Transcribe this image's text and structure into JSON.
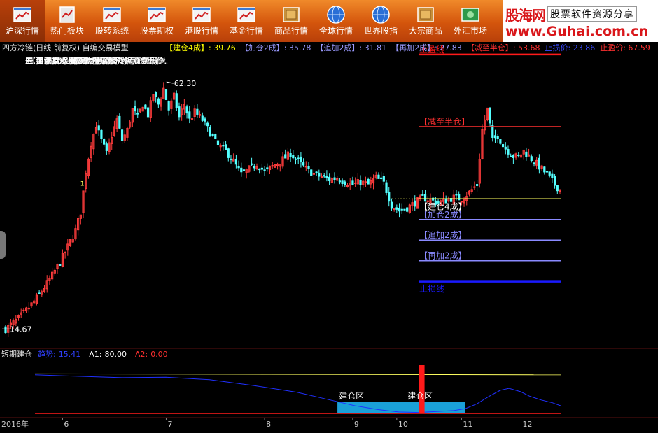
{
  "toolbar": {
    "buttons": [
      {
        "label": "沪深行情",
        "icon": "chart-window-icon",
        "active": true
      },
      {
        "label": "热门板块",
        "icon": "bookmark-icon",
        "active": false
      },
      {
        "label": "股转系统",
        "icon": "chart-window-icon",
        "active": false
      },
      {
        "label": "股票期权",
        "icon": "chart-window-icon",
        "active": false
      },
      {
        "label": "港股行情",
        "icon": "chart-window-icon",
        "active": false
      },
      {
        "label": "基金行情",
        "icon": "chart-window-icon",
        "active": false
      },
      {
        "label": "商品行情",
        "icon": "crate-icon",
        "active": false
      },
      {
        "label": "全球行情",
        "icon": "globe-icon",
        "active": false
      },
      {
        "label": "世界股指",
        "icon": "globe-icon",
        "active": false
      },
      {
        "label": "大宗商品",
        "icon": "box-icon",
        "active": false
      },
      {
        "label": "外汇市场",
        "icon": "money-icon",
        "active": false
      }
    ]
  },
  "brand": {
    "logo": "股海网",
    "slogan": "股票软件资源分享",
    "url": "www.Guhai.com.cn"
  },
  "chart_title": "四方冷链(日线 前复权) 自编交易模型",
  "header_indicators": [
    {
      "label": "【建仓4成】",
      "value": ": 39.76",
      "color": "#ffff00"
    },
    {
      "label": "【加仓2成】",
      "value": ": 35.78",
      "color": "#9a9aff"
    },
    {
      "label": "【追加2成】",
      "value": ": 31.81",
      "color": "#9a9aff"
    },
    {
      "label": "【再加2成】",
      "value": ": 27.83",
      "color": "#9a9aff"
    },
    {
      "label": "【减至半仓】",
      "value": ": 53.68",
      "color": "#ff3030"
    },
    {
      "label": "止损价",
      "value": ": 23.86",
      "color": "#3a4aff"
    },
    {
      "label": "止盈价",
      "value": ": 67.59",
      "color": "#ff3030"
    }
  ],
  "rules": [
    "【自编交易模型】探索版",
    "一.买入指标出现信号后建仓,用4成仓位.",
    "二.每跌10%加2成仓,加3次仓,直到满仓.",
    "三.上涨35%减至半仓.",
    "四.上涨70%清仓,或视情况移动止盈.",
    "五.建仓后上涨70%止盈,下跌40%止损!"
  ],
  "price_annotations": {
    "high": "62.30",
    "low": "14.67",
    "signal": "1"
  },
  "level_labels": {
    "take_profit": "止盈线",
    "reduce": "【减至半仓】",
    "build": "【建仓4成】",
    "add1": "【加仓2成】",
    "add2": "【追加2成】",
    "add3": "【再加2成】",
    "stop": "止损线"
  },
  "sub_header": {
    "name": "短期建仓",
    "items": [
      {
        "label": "趋势:",
        "value": "15.41",
        "color": "#3040ff"
      },
      {
        "label": "A1:",
        "value": "80.00",
        "color": "#ffffff"
      },
      {
        "label": "A2:",
        "value": "0.00",
        "color": "#ff3030"
      }
    ]
  },
  "sub_labels": {
    "zone1": "建仓区",
    "zone2": "建仓区"
  },
  "x_axis": {
    "year": "2016年",
    "months": [
      "6",
      "7",
      "8",
      "9",
      "10",
      "11",
      "12"
    ]
  },
  "colors": {
    "up": "#ff3c3c",
    "down": "#54ffff",
    "take_profit": "#ff1a1a",
    "reduce": "#ff3030",
    "build": "#ffff60",
    "add": "#8a8aff",
    "stop": "#1a1aff",
    "trend": "#2030ff",
    "a1": "#ffff60",
    "zone": "#1aa0d8",
    "signal_bar": "#ff1a1a"
  },
  "chart_data": [
    {
      "type": "candlestick",
      "title": "四方冷链(日线 前复权) 自编交易模型",
      "x_range": [
        "2016-05",
        "2016-12"
      ],
      "ylim": [
        13.5,
        70
      ],
      "annotated_high": 62.3,
      "annotated_low": 14.67,
      "levels": [
        {
          "name": "止盈价",
          "value": 67.59
        },
        {
          "name": "减至半仓",
          "value": 53.68
        },
        {
          "name": "建仓4成",
          "value": 39.76
        },
        {
          "name": "加仓2成",
          "value": 35.78
        },
        {
          "name": "追加2成",
          "value": 31.81
        },
        {
          "name": "再加2成",
          "value": 27.83
        },
        {
          "name": "止损价",
          "value": 23.86
        }
      ],
      "close_profile": [
        [
          0,
          14.67
        ],
        [
          3,
          15.8
        ],
        [
          6,
          17.2
        ],
        [
          9,
          18.8
        ],
        [
          12,
          20.6
        ],
        [
          15,
          22.7
        ],
        [
          18,
          25
        ],
        [
          21,
          27.6
        ],
        [
          24,
          30.5
        ],
        [
          27,
          33.7
        ],
        [
          29,
          37.2
        ],
        [
          31,
          45
        ],
        [
          33,
          50.5
        ],
        [
          35,
          54
        ],
        [
          37,
          51
        ],
        [
          39,
          48.5
        ],
        [
          41,
          52
        ],
        [
          43,
          55
        ],
        [
          45,
          51
        ],
        [
          47,
          53
        ],
        [
          49,
          57
        ],
        [
          51,
          55.5
        ],
        [
          53,
          58
        ],
        [
          55,
          56
        ],
        [
          57,
          60
        ],
        [
          59,
          58
        ],
        [
          61,
          61
        ],
        [
          63,
          57
        ],
        [
          65,
          59.5
        ],
        [
          67,
          55.5
        ],
        [
          69,
          58
        ],
        [
          71,
          55
        ],
        [
          73,
          56.5
        ],
        [
          76,
          55
        ],
        [
          79,
          52.5
        ],
        [
          82,
          50
        ],
        [
          85,
          49
        ],
        [
          88,
          47
        ],
        [
          91,
          44.5
        ],
        [
          94,
          45.5
        ],
        [
          97,
          46.5
        ],
        [
          100,
          45
        ],
        [
          103,
          46
        ],
        [
          106,
          47
        ],
        [
          110,
          48.5
        ],
        [
          113,
          47
        ],
        [
          116,
          45.5
        ],
        [
          119,
          44.5
        ],
        [
          122,
          44
        ],
        [
          125,
          43.5
        ],
        [
          128,
          43.8
        ],
        [
          131,
          43
        ],
        [
          134,
          42.5
        ],
        [
          137,
          43
        ],
        [
          140,
          42.5
        ],
        [
          143,
          43.8
        ],
        [
          146,
          42.8
        ],
        [
          149,
          38.5
        ],
        [
          152,
          37.5
        ],
        [
          155,
          38
        ],
        [
          158,
          39
        ],
        [
          161,
          40
        ],
        [
          164,
          39.5
        ],
        [
          167,
          39
        ],
        [
          170,
          39.5
        ],
        [
          173,
          40
        ],
        [
          176,
          39.8
        ],
        [
          179,
          41
        ],
        [
          182,
          42.5
        ],
        [
          184,
          53
        ],
        [
          186,
          57
        ],
        [
          188,
          51
        ],
        [
          190,
          52
        ],
        [
          192,
          50
        ],
        [
          194,
          49
        ],
        [
          196,
          48
        ],
        [
          198,
          47.8
        ],
        [
          200,
          49
        ],
        [
          203,
          47.5
        ],
        [
          206,
          46
        ],
        [
          209,
          44.5
        ],
        [
          212,
          42.5
        ],
        [
          214,
          41.5
        ]
      ]
    },
    {
      "type": "line",
      "title": "短期建仓",
      "ylim": [
        0,
        100
      ],
      "series": [
        {
          "name": "趋势",
          "last": 15.41,
          "values": [
            [
              0,
              80
            ],
            [
              10,
              78
            ],
            [
              30,
              74
            ],
            [
              45,
              75
            ],
            [
              60,
              70
            ],
            [
              75,
              58
            ],
            [
              90,
              44
            ],
            [
              100,
              30
            ],
            [
              110,
              16
            ],
            [
              118,
              8
            ],
            [
              125,
              3
            ],
            [
              132,
              2
            ],
            [
              138,
              4
            ],
            [
              144,
              6
            ],
            [
              148,
              10
            ],
            [
              152,
              20
            ],
            [
              156,
              35
            ],
            [
              160,
              48
            ],
            [
              163,
              52
            ],
            [
              167,
              45
            ],
            [
              170,
              36
            ],
            [
              174,
              28
            ],
            [
              178,
              22
            ],
            [
              181,
              15.41
            ]
          ]
        },
        {
          "name": "A1",
          "last": 80.0,
          "values": [
            [
              0,
              82
            ],
            [
              181,
              80
            ]
          ]
        },
        {
          "name": "A2",
          "last": 0.0,
          "values": [
            [
              0,
              0
            ],
            [
              181,
              0
            ]
          ]
        }
      ],
      "zones": [
        {
          "label": "建仓区",
          "x_start": 104,
          "x_end": 148
        },
        {
          "label": "建仓区",
          "x_start": 104,
          "x_end": 148
        }
      ],
      "signal_bar": {
        "x": 133,
        "height": 100
      }
    }
  ]
}
